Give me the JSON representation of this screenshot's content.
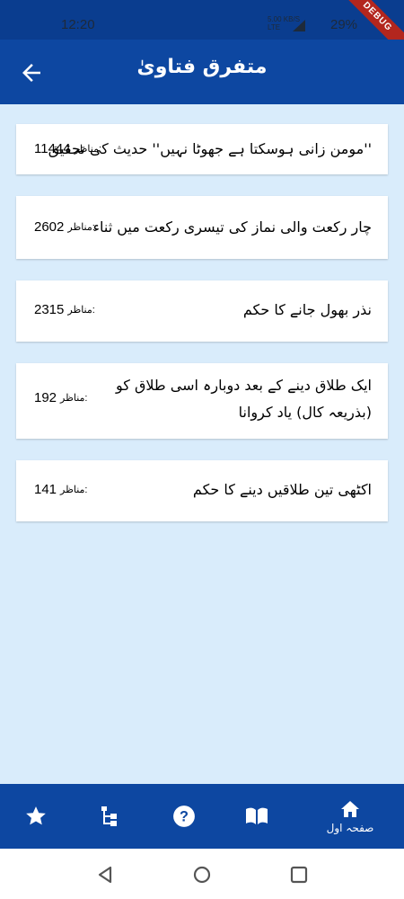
{
  "status_bar": {
    "time": "12:20",
    "network_top": "5.00 KB/S",
    "network_bottom": "LTE",
    "battery": "29%",
    "debug_label": "DEBUG"
  },
  "app_bar": {
    "title": "متفرق فتاویٰ",
    "back_icon": "arrow-left-icon"
  },
  "items": [
    {
      "title": "''مومن زانی ہوسکتا ہے جھوٹا نہیں'' حدیث کی تحقیق",
      "views_label": "مناظر:",
      "views": "11444"
    },
    {
      "title": "چار رکعت والی نماز کی تیسری رکعت میں ثناء",
      "views_label": "مناظر:",
      "views": "2602"
    },
    {
      "title": "نذر بھول جانے کا حکم",
      "views_label": "مناظر:",
      "views": "2315"
    },
    {
      "title": "ایک طلاق دینے کے بعد دوبارہ اسی طلاق کو (بذریعہ کال) یاد کروانا",
      "views_label": "مناظر:",
      "views": "192"
    },
    {
      "title": "اکٹھی تین طلاقیں دینے کا حکم",
      "views_label": "مناظر:",
      "views": "141"
    }
  ],
  "bottom_nav": {
    "home_label": "صفحہ اول",
    "icons": [
      "star-icon",
      "sitemap-icon",
      "help-icon",
      "book-icon",
      "home-icon"
    ]
  },
  "colors": {
    "primary": "#0d47a1",
    "background": "#d9ecfb",
    "card": "#ffffff"
  }
}
